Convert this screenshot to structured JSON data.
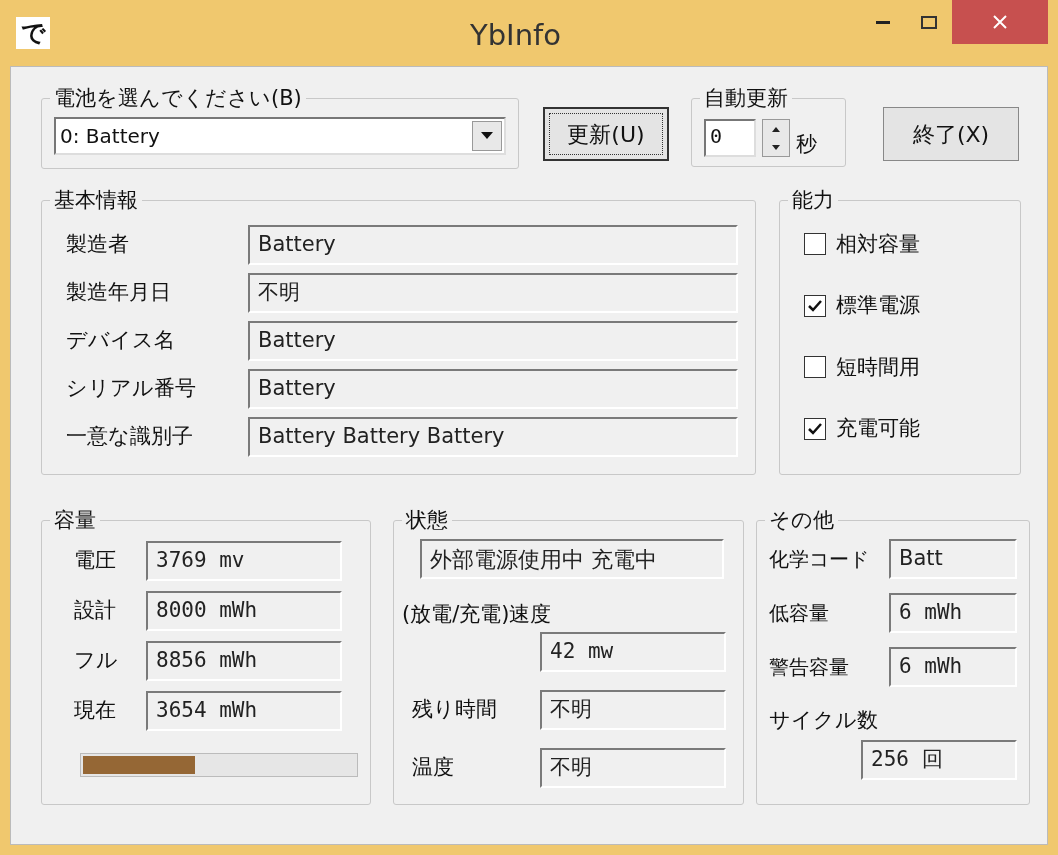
{
  "window": {
    "icon_text": "で",
    "title": "YbInfo"
  },
  "battery_select": {
    "label": "電池を選んでください(B)",
    "value": "0: Battery"
  },
  "update_button": "更新(U)",
  "auto_update": {
    "label": "自動更新",
    "value": "0",
    "unit": "秒"
  },
  "exit_button": "終了(X)",
  "basic_info": {
    "title": "基本情報",
    "fields": [
      {
        "label": "製造者",
        "value": "Battery"
      },
      {
        "label": "製造年月日",
        "value": "不明"
      },
      {
        "label": "デバイス名",
        "value": "Battery"
      },
      {
        "label": "シリアル番号",
        "value": "Battery"
      },
      {
        "label": "一意な識別子",
        "value": "Battery Battery Battery"
      }
    ]
  },
  "capabilities": {
    "title": "能力",
    "items": [
      {
        "label": "相対容量",
        "checked": false
      },
      {
        "label": "標準電源",
        "checked": true
      },
      {
        "label": "短時間用",
        "checked": false
      },
      {
        "label": "充電可能",
        "checked": true
      }
    ]
  },
  "capacity": {
    "title": "容量",
    "fields": [
      {
        "label": "電圧",
        "value": "3769 mv"
      },
      {
        "label": "設計",
        "value": "8000 mWh"
      },
      {
        "label": "フル",
        "value": "8856 mWh"
      },
      {
        "label": "現在",
        "value": "3654 mWh"
      }
    ],
    "level": 0.41
  },
  "status": {
    "title": "状態",
    "state": "外部電源使用中 充電中",
    "rate_label": "(放電/充電)速度",
    "rate": "42 mw",
    "fields": [
      {
        "label": "残り時間",
        "value": "不明"
      },
      {
        "label": "温度",
        "value": "不明"
      }
    ]
  },
  "other": {
    "title": "その他",
    "fields": [
      {
        "label": "化学コード",
        "value": "Batt"
      },
      {
        "label": "低容量",
        "value": "6 mWh"
      },
      {
        "label": "警告容量",
        "value": "6 mWh"
      }
    ],
    "cycle_label": "サイクル数",
    "cycle": "256 回"
  }
}
